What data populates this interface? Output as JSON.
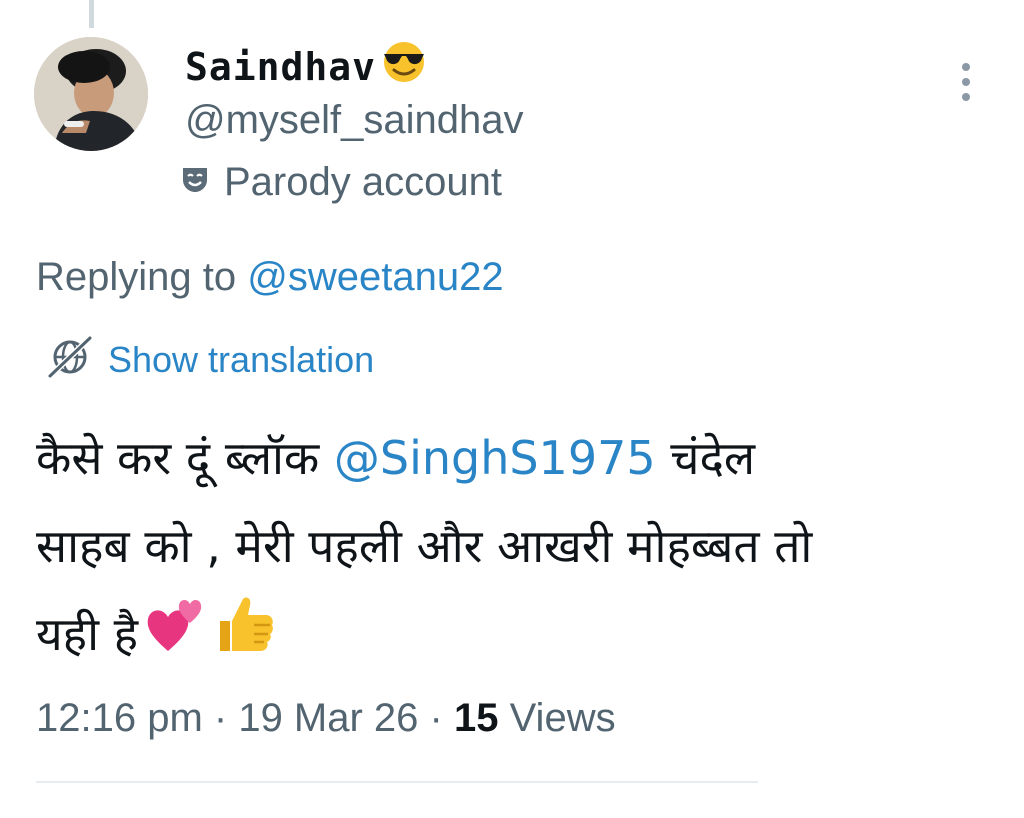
{
  "tweet": {
    "display_name": "Saindhav",
    "handle": "@myself_saindhav",
    "badge_label": "Parody account",
    "replying_prefix": "Replying to ",
    "replying_handle": "@sweetanu22",
    "translate_label": "Show translation",
    "text_line1_before": "कैसे कर दूं ब्लॉक ",
    "text_mention": "@SinghS1975",
    "text_line1_after": " चंदेल",
    "text_line2": "साहब को , मेरी पहली और आखरी मोहब्बत तो",
    "text_line3": "यही है",
    "time": "12:16 pm",
    "separator": " · ",
    "date": "19 Mar 26",
    "views_count": "15",
    "views_label": " Views"
  },
  "icons": {
    "name_emoji": "smiling-face-with-sunglasses-icon",
    "badge_icon": "theater-mask-icon",
    "translate_icon": "globe-slash-icon",
    "more_icon": "vertical-ellipsis-icon",
    "text_emojis": [
      "two-hearts-icon",
      "thumbs-up-icon"
    ]
  },
  "colors": {
    "link": "#2a85c7",
    "secondary_text": "#536471",
    "primary_text": "#0f1419",
    "emoji_yellow": "#f7c22b",
    "heart_pink": "#e8357f"
  }
}
